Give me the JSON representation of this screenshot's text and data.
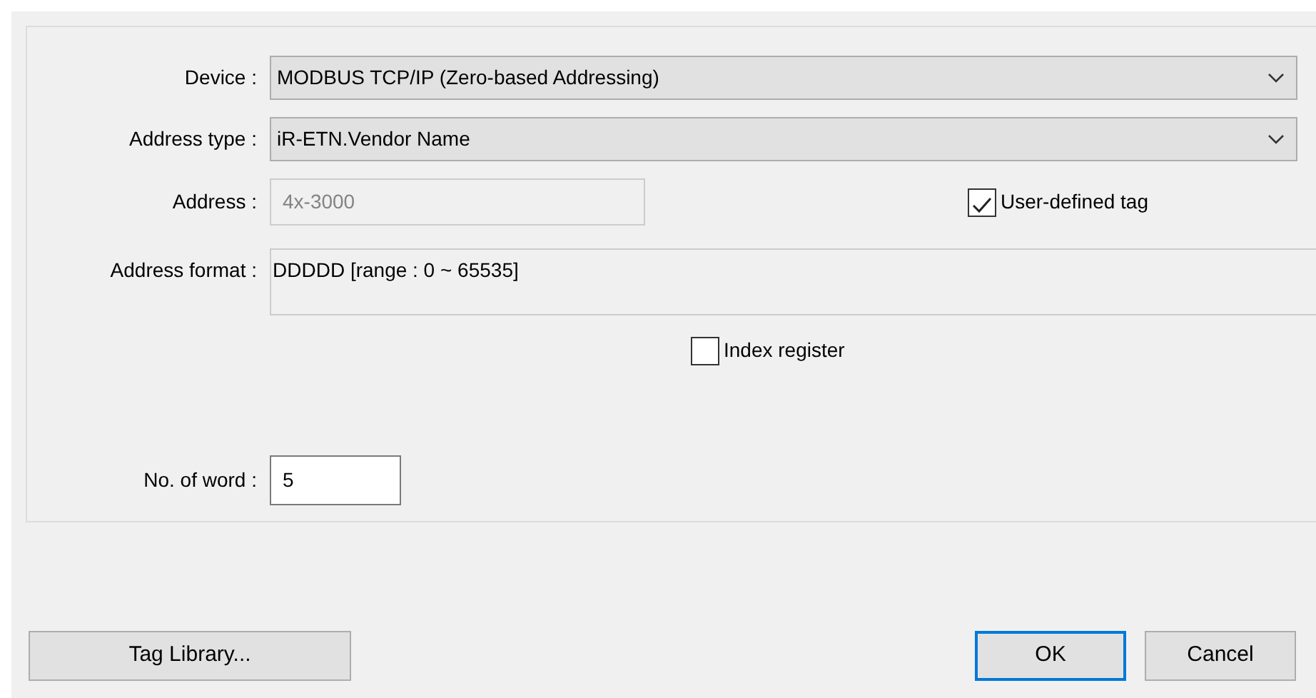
{
  "form": {
    "device": {
      "label": "Device :",
      "value": "MODBUS TCP/IP (Zero-based Addressing)"
    },
    "address_type": {
      "label": "Address type :",
      "value": "iR-ETN.Vendor Name"
    },
    "address": {
      "label": "Address :",
      "value": "4x-3000",
      "disabled": true
    },
    "user_defined_tag": {
      "label": "User-defined tag",
      "checked": true
    },
    "address_format": {
      "label": "Address format :",
      "value": "DDDDD [range : 0 ~ 65535]"
    },
    "index_register": {
      "label": "Index register",
      "checked": false
    },
    "no_of_word": {
      "label": "No. of word :",
      "value": "5"
    }
  },
  "buttons": [
    {
      "label": "Tag Library...",
      "kind": "normal"
    },
    {
      "label": "OK",
      "kind": "default"
    },
    {
      "label": "Cancel",
      "kind": "normal"
    }
  ]
}
